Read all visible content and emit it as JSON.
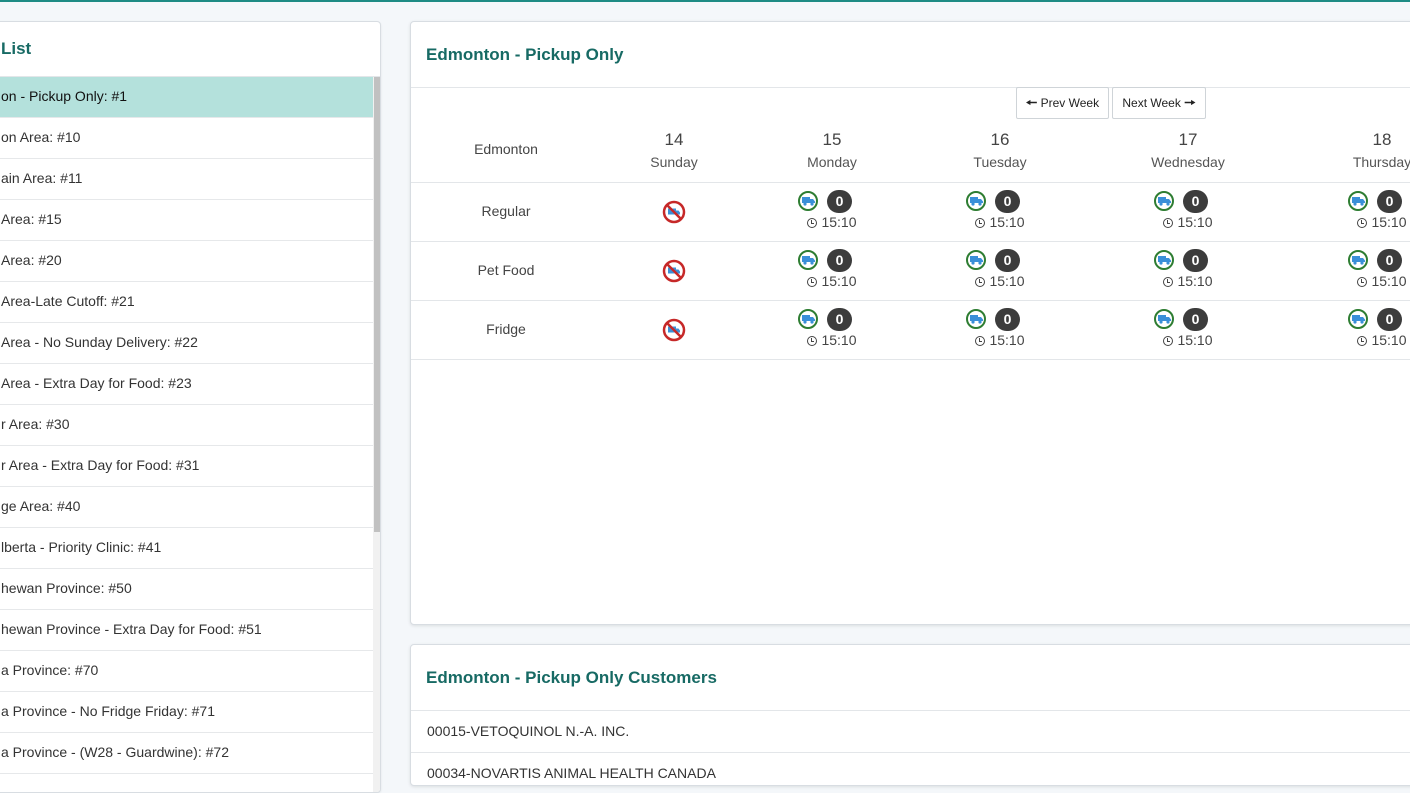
{
  "left_panel": {
    "title": "List",
    "items": [
      {
        "label": "on - Pickup Only: #1",
        "active": true
      },
      {
        "label": "on Area: #10"
      },
      {
        "label": "ain Area: #11"
      },
      {
        "label": "Area: #15"
      },
      {
        "label": "Area: #20"
      },
      {
        "label": "Area-Late Cutoff: #21"
      },
      {
        "label": "Area - No Sunday Delivery: #22"
      },
      {
        "label": "Area - Extra Day for Food: #23"
      },
      {
        "label": "r Area: #30"
      },
      {
        "label": "r Area - Extra Day for Food: #31"
      },
      {
        "label": "ge Area: #40"
      },
      {
        "label": "lberta - Priority Clinic: #41"
      },
      {
        "label": "hewan Province: #50"
      },
      {
        "label": "hewan Province - Extra Day for Food: #51"
      },
      {
        "label": "a Province: #70"
      },
      {
        "label": "a Province - No Fridge Friday: #71"
      },
      {
        "label": "a Province - (W28 - Guardwine): #72"
      }
    ]
  },
  "schedule": {
    "title": "Edmonton - Pickup Only",
    "prev_label": "Prev Week",
    "next_label": "Next Week",
    "location": "Edmonton",
    "days": [
      {
        "num": "14",
        "name": "Sunday"
      },
      {
        "num": "15",
        "name": "Monday"
      },
      {
        "num": "16",
        "name": "Tuesday"
      },
      {
        "num": "17",
        "name": "Wednesday"
      },
      {
        "num": "18",
        "name": "Thursday"
      }
    ],
    "rows": [
      {
        "label": "Regular",
        "slots": [
          {
            "blocked": true
          },
          {
            "count": "0",
            "time": "15:10"
          },
          {
            "count": "0",
            "time": "15:10"
          },
          {
            "count": "0",
            "time": "15:10"
          },
          {
            "count": "0",
            "time": "15:10"
          }
        ]
      },
      {
        "label": "Pet Food",
        "slots": [
          {
            "blocked": true
          },
          {
            "count": "0",
            "time": "15:10"
          },
          {
            "count": "0",
            "time": "15:10"
          },
          {
            "count": "0",
            "time": "15:10"
          },
          {
            "count": "0",
            "time": "15:10"
          }
        ]
      },
      {
        "label": "Fridge",
        "slots": [
          {
            "blocked": true
          },
          {
            "count": "0",
            "time": "15:10"
          },
          {
            "count": "0",
            "time": "15:10"
          },
          {
            "count": "0",
            "time": "15:10"
          },
          {
            "count": "0",
            "time": "15:10"
          }
        ]
      }
    ]
  },
  "customers": {
    "title": "Edmonton - Pickup Only Customers",
    "items": [
      "00015-VETOQUINOL N.-A. INC.",
      "00034-NOVARTIS ANIMAL HEALTH CANADA"
    ]
  },
  "colors": {
    "accent": "#176a64",
    "active_row": "#b4e1dc",
    "truck": "#3a8fd8",
    "blocked": "#c62828"
  }
}
